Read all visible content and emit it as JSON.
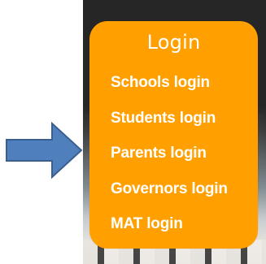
{
  "menu": {
    "title": "Login",
    "items": [
      {
        "label": "Schools login"
      },
      {
        "label": "Students login"
      },
      {
        "label": "Parents login"
      },
      {
        "label": "Governors login"
      },
      {
        "label": "MAT login"
      }
    ],
    "accent_color": "#ffa000",
    "text_color": "#ffffff"
  },
  "annotation": {
    "icon": "arrow-right-icon",
    "color": "#4f7fbd"
  }
}
